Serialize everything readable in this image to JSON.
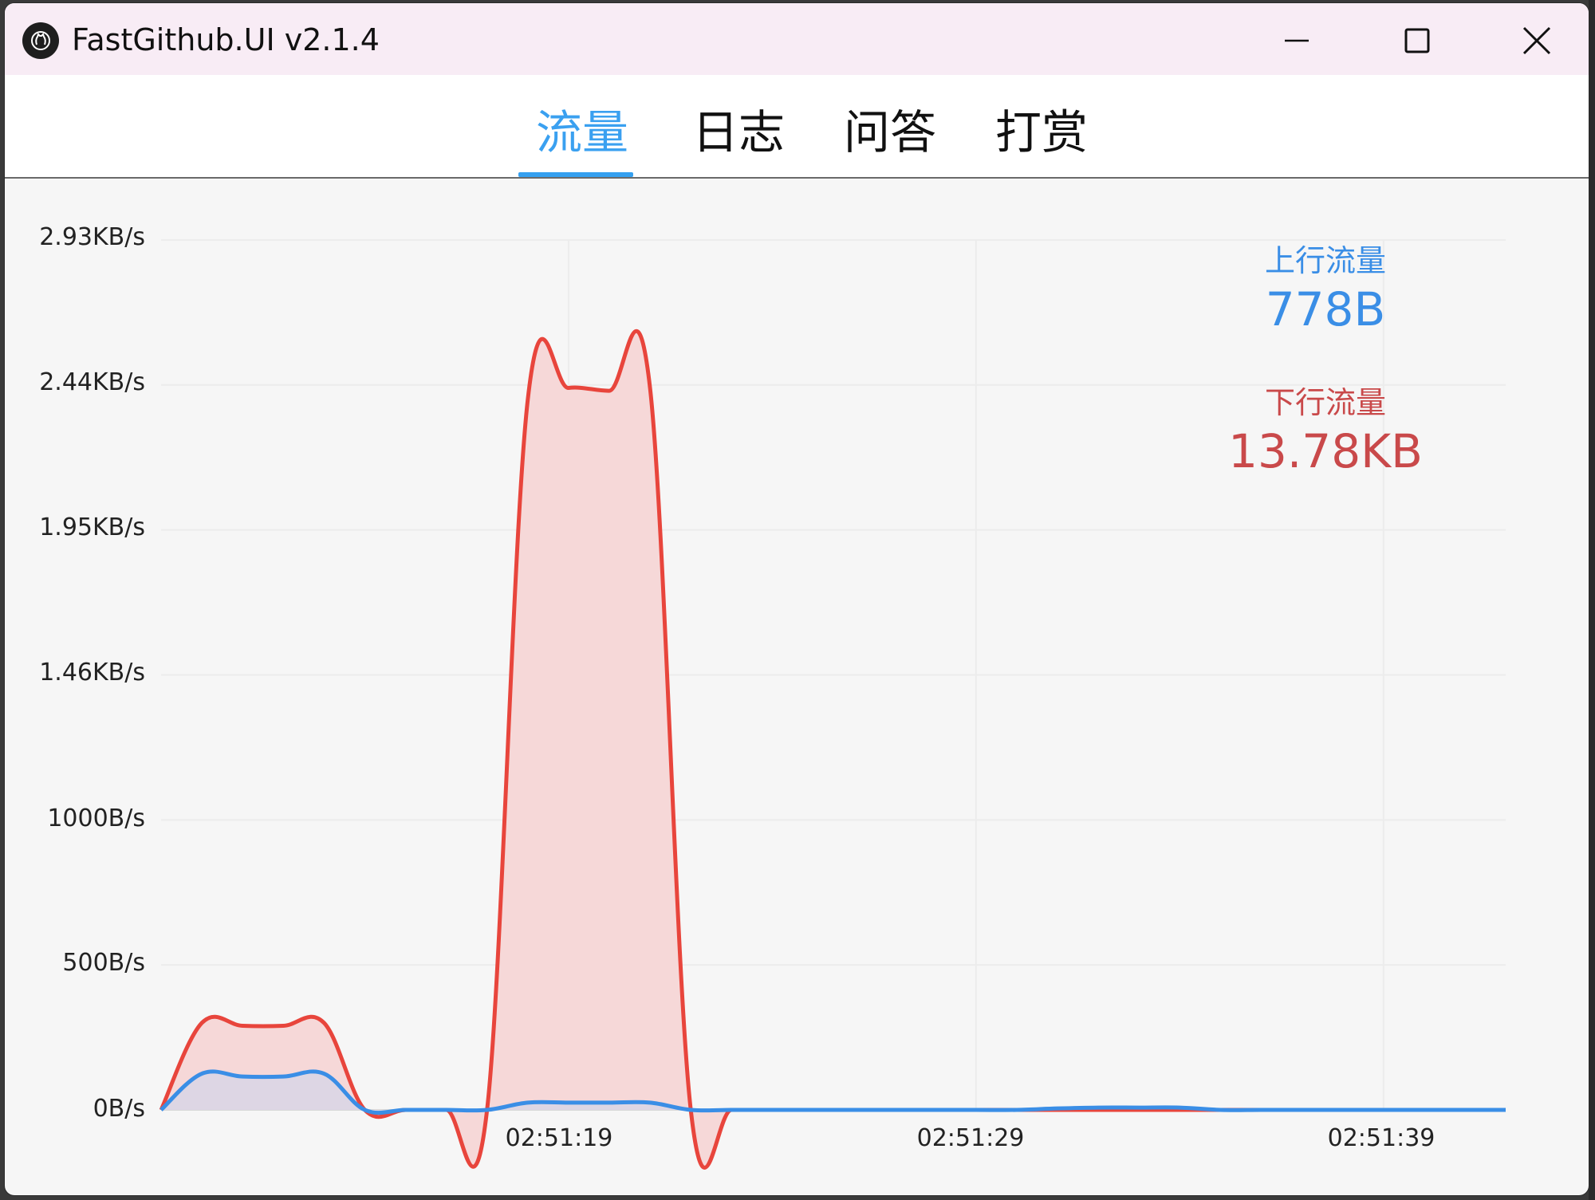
{
  "window": {
    "title": "FastGithub.UI v2.1.4",
    "icon": "github-icon"
  },
  "tabs": [
    {
      "label": "流量",
      "active": true
    },
    {
      "label": "日志",
      "active": false
    },
    {
      "label": "问答",
      "active": false
    },
    {
      "label": "打赏",
      "active": false
    }
  ],
  "stats": {
    "upload_label": "上行流量",
    "upload_value": "778B",
    "download_label": "下行流量",
    "download_value": "13.78KB",
    "upload_color": "#3a8ee6",
    "download_color": "#c9494a"
  },
  "chart_data": {
    "type": "area",
    "y_tick_labels": [
      "2.93KB/s",
      "2.44KB/s",
      "1.95KB/s",
      "1.46KB/s",
      "1000B/s",
      "500B/s",
      "0B/s"
    ],
    "y_ticks_bytes": [
      3000,
      2500,
      2000,
      1500,
      1000,
      500,
      0
    ],
    "ylim": [
      0,
      3000
    ],
    "x_tick_labels": [
      "02:51:19",
      "02:51:29",
      "02:51:39"
    ],
    "x_tick_seconds": [
      10,
      20,
      30
    ],
    "xlim": [
      0,
      33
    ],
    "grid": true,
    "series": [
      {
        "color": "#e8453c",
        "fill": "#f6d8d8",
        "points": [
          [
            0,
            0
          ],
          [
            1,
            300
          ],
          [
            2,
            290
          ],
          [
            3,
            290
          ],
          [
            4,
            300
          ],
          [
            5,
            0
          ],
          [
            6,
            0
          ],
          [
            7,
            0
          ],
          [
            8,
            0
          ],
          [
            9,
            2450
          ],
          [
            10,
            2490
          ],
          [
            11,
            2480
          ],
          [
            12,
            2490
          ],
          [
            13,
            0
          ],
          [
            14,
            0
          ],
          [
            15,
            0
          ],
          [
            16,
            0
          ],
          [
            17,
            0
          ],
          [
            18,
            0
          ],
          [
            19,
            0
          ],
          [
            20,
            0
          ],
          [
            21,
            0
          ],
          [
            22,
            0
          ],
          [
            23,
            0
          ],
          [
            24,
            0
          ],
          [
            25,
            0
          ],
          [
            26,
            0
          ],
          [
            27,
            0
          ],
          [
            28,
            0
          ],
          [
            29,
            0
          ],
          [
            30,
            0
          ],
          [
            31,
            0
          ],
          [
            32,
            0
          ],
          [
            33,
            0
          ]
        ]
      },
      {
        "color": "#3a8ee6",
        "fill": "#d8d6e6",
        "points": [
          [
            0,
            0
          ],
          [
            1,
            125
          ],
          [
            2,
            115
          ],
          [
            3,
            115
          ],
          [
            4,
            125
          ],
          [
            5,
            0
          ],
          [
            6,
            0
          ],
          [
            7,
            0
          ],
          [
            8,
            0
          ],
          [
            9,
            25
          ],
          [
            10,
            25
          ],
          [
            11,
            25
          ],
          [
            12,
            25
          ],
          [
            13,
            0
          ],
          [
            14,
            0
          ],
          [
            15,
            0
          ],
          [
            16,
            0
          ],
          [
            17,
            0
          ],
          [
            18,
            0
          ],
          [
            19,
            0
          ],
          [
            20,
            0
          ],
          [
            21,
            0
          ],
          [
            22,
            5
          ],
          [
            23,
            8
          ],
          [
            24,
            8
          ],
          [
            25,
            8
          ],
          [
            26,
            0
          ],
          [
            27,
            0
          ],
          [
            28,
            0
          ],
          [
            29,
            0
          ],
          [
            30,
            0
          ],
          [
            31,
            0
          ],
          [
            32,
            0
          ],
          [
            33,
            0
          ]
        ]
      }
    ]
  }
}
